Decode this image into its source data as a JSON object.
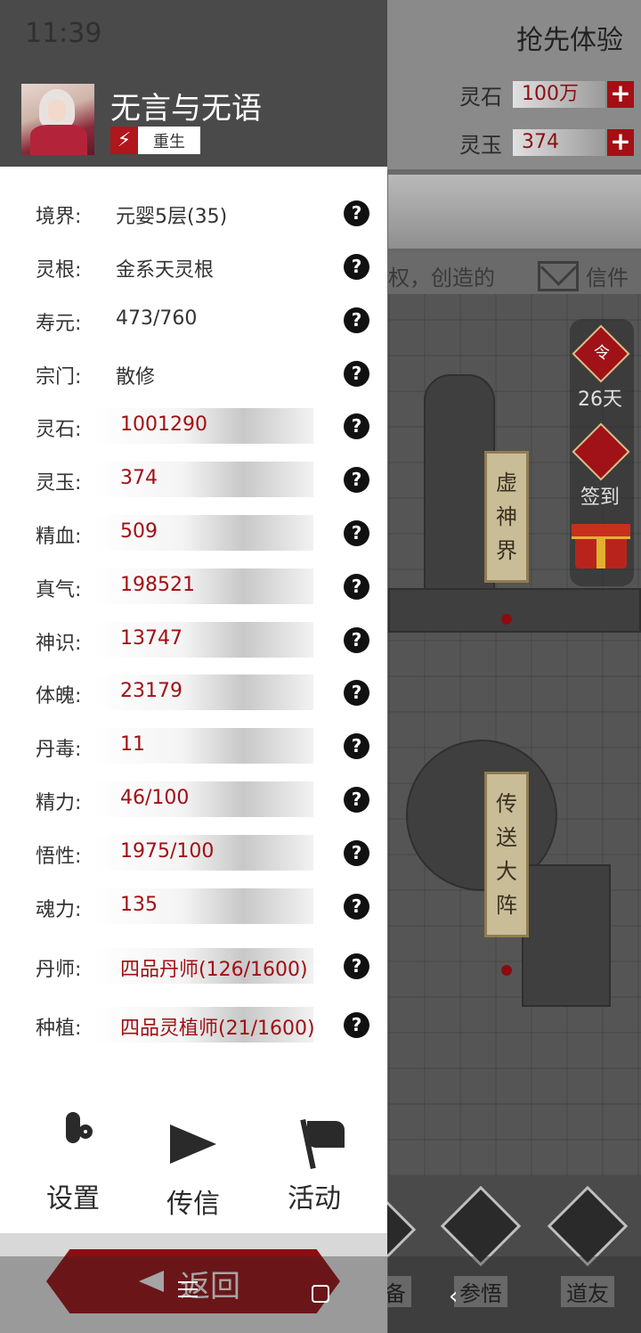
{
  "status_bar": {
    "time": "11:39"
  },
  "background": {
    "header_title": "抢先体验",
    "resources": [
      {
        "label": "灵石",
        "value": "100万"
      },
      {
        "label": "灵玉",
        "value": "374"
      }
    ],
    "notice": "权，创造的",
    "mail_label": "信件",
    "side_panel": {
      "ling_label": "令",
      "ling_days": "26天",
      "sign_in_label": "签到"
    },
    "plaques": {
      "realm": [
        "虚",
        "神",
        "界"
      ],
      "teleport": [
        "传",
        "送",
        "大",
        "阵"
      ]
    },
    "bottom_nav": [
      "备",
      "参悟",
      "道友"
    ]
  },
  "profile": {
    "username": "无言与无语",
    "badge_label": "重生"
  },
  "stats": [
    {
      "label": "境界:",
      "value": "元婴5层(35)",
      "style": "plain"
    },
    {
      "label": "灵根:",
      "value": "金系天灵根",
      "style": "plain"
    },
    {
      "label": "寿元:",
      "value": "473/760",
      "style": "plain"
    },
    {
      "label": "宗门:",
      "value": "散修",
      "style": "plain"
    },
    {
      "label": "灵石:",
      "value": "1001290",
      "style": "box"
    },
    {
      "label": "灵玉:",
      "value": "374",
      "style": "box"
    },
    {
      "label": "精血:",
      "value": "509",
      "style": "box"
    },
    {
      "label": "真气:",
      "value": "198521",
      "style": "box"
    },
    {
      "label": "神识:",
      "value": "13747",
      "style": "box"
    },
    {
      "label": "体魄:",
      "value": "23179",
      "style": "box"
    },
    {
      "label": "丹毒:",
      "value": "11",
      "style": "box"
    },
    {
      "label": "精力:",
      "value": "46/100",
      "style": "box"
    },
    {
      "label": "悟性:",
      "value": "1975/100",
      "style": "box"
    },
    {
      "label": "魂力:",
      "value": "135",
      "style": "box"
    },
    {
      "label": "丹师:",
      "value": "四品丹师(126/1600)",
      "style": "box"
    },
    {
      "label": "种植:",
      "value": "四品灵植师(21/1600)",
      "style": "box"
    }
  ],
  "help_glyph": "?",
  "menu": [
    {
      "label": "设置",
      "icon": "gear-icon"
    },
    {
      "label": "传信",
      "icon": "send-icon"
    },
    {
      "label": "活动",
      "icon": "flag-icon"
    }
  ],
  "back_label": "返回",
  "plus_glyph": "+",
  "bolt_glyph": "⚡",
  "nav_back_glyph": "‹"
}
